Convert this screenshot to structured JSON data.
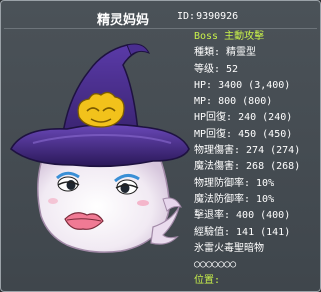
{
  "monster": {
    "name": "精灵妈妈",
    "id_label": "ID:",
    "id_value": "9390926"
  },
  "stats": [
    {
      "key": "boss_type",
      "text": "Boss 主動攻擊"
    },
    {
      "key": "species",
      "text": "種類: 精靈型"
    },
    {
      "key": "level",
      "text": "等级: 52"
    },
    {
      "key": "hp",
      "text": "HP: 3400 (3,400)"
    },
    {
      "key": "mp",
      "text": "MP: 800 (800)"
    },
    {
      "key": "hp_regen",
      "text": "HP回復: 240 (240)"
    },
    {
      "key": "mp_regen",
      "text": "MP回復: 450 (450)"
    },
    {
      "key": "phys_dmg",
      "text": "物理傷害: 274 (274)"
    },
    {
      "key": "magic_dmg",
      "text": "魔法傷害: 268 (268)"
    },
    {
      "key": "phys_def",
      "text": "物理防御率: 10%"
    },
    {
      "key": "magic_def",
      "text": "魔法防御率: 10%"
    },
    {
      "key": "evasion",
      "text": "擊退率: 400 (400)"
    },
    {
      "key": "exp",
      "text": "經驗值: 141 (141)"
    },
    {
      "key": "elements",
      "text": "氷雷火毒聖暗物"
    },
    {
      "key": "element_slots",
      "text": "○○○○○○○"
    },
    {
      "key": "position",
      "text": "位置:"
    }
  ],
  "colors": {
    "background": "#444b51",
    "border": "#9ba2a8",
    "highlight": "#c8f04a",
    "hat": "#4a2a8a",
    "hat_emblem": "#f2c21b"
  },
  "icons": [
    "witch-hat-icon",
    "ghost-body-icon"
  ]
}
